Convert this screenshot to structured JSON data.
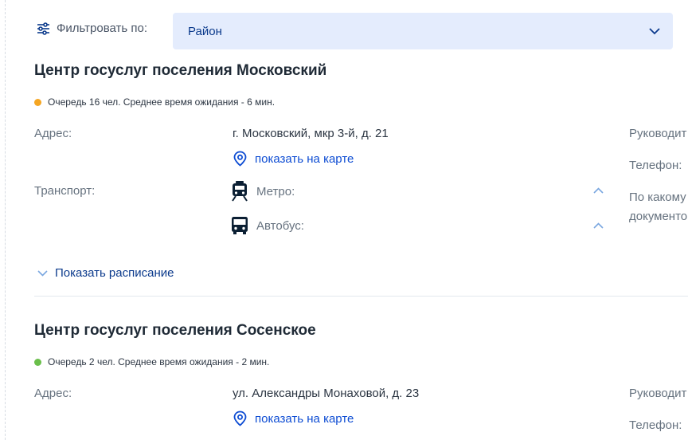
{
  "filter": {
    "label": "Фильтровать по:",
    "value": "Район"
  },
  "centers": [
    {
      "title": "Центр госуслуг поселения Московский",
      "queue_text": "Очередь 16 чел. Среднее время ожидания - 6 мин.",
      "queue_color": "#f5a623",
      "address_label": "Адрес:",
      "address": "г. Московский, мкр 3-й, д. 21",
      "map_link": "показать на карте",
      "transport_label": "Транспорт:",
      "metro_label": "Метро:",
      "bus_label": "Автобус:",
      "head_label": "Руководит",
      "phone_label": "Телефон:",
      "docs_line1": "По какому",
      "docs_line2": "документо",
      "schedule_link": "Показать расписание"
    },
    {
      "title": "Центр госуслуг поселения Сосенское",
      "queue_text": "Очередь 2 чел. Среднее время ожидания - 2 мин.",
      "queue_color": "#6abf4b",
      "address_label": "Адрес:",
      "address": "ул. Александры Монаховой, д. 23",
      "map_link": "показать на карте",
      "head_label": "Руководит",
      "phone_label": "Телефон:"
    }
  ],
  "icons": {
    "filter": "sliders-icon",
    "select_arrow": "chevron-down-icon",
    "map": "map-pin-icon",
    "metro": "metro-train-icon",
    "bus": "bus-icon",
    "collapse": "chevron-up-icon",
    "expand": "chevron-down-icon"
  },
  "colors": {
    "accent": "#0d4cd3",
    "select_bg": "#e4ecfd"
  }
}
